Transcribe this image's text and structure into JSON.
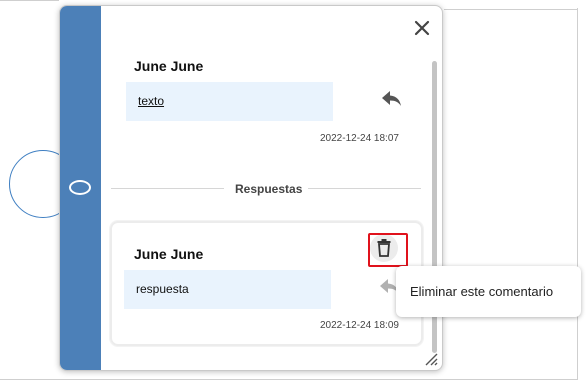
{
  "comment": {
    "author": "June June",
    "text": "texto",
    "timestamp": "2022-12-24 18:07"
  },
  "replies_section": {
    "label": "Respuestas"
  },
  "reply": {
    "author": "June June",
    "text": "respuesta",
    "timestamp": "2022-12-24 18:09"
  },
  "tooltip": {
    "text": "Eliminar este comentario"
  },
  "icons": {
    "close": "close-icon",
    "reply": "reply-icon",
    "delete": "trash-icon",
    "resize": "resize-handle-icon",
    "marker": "ellipse-marker-icon"
  },
  "colors": {
    "accent": "#4c80b8",
    "bubble": "#e9f3fd",
    "highlight": "#e0121c",
    "shape_stroke": "#3f7fc2"
  }
}
